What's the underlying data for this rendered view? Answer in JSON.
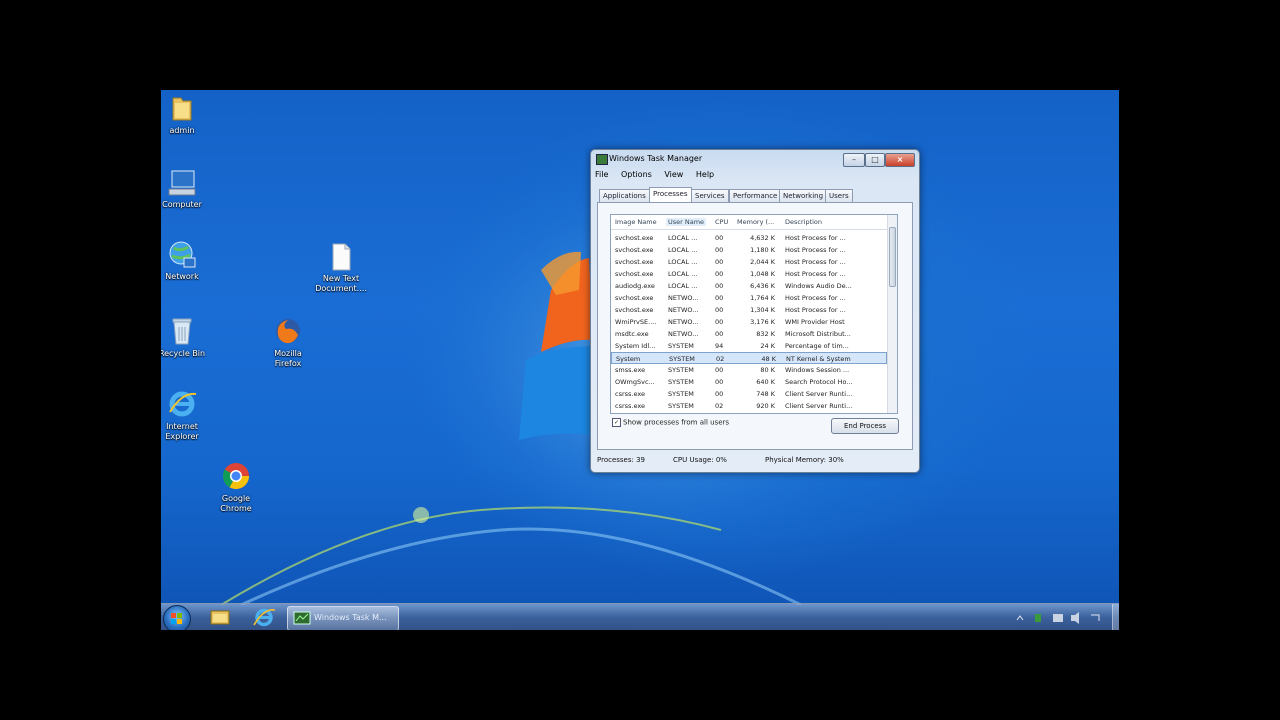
{
  "desktop_icons": [
    {
      "label": "admin",
      "icon": "folder-icon"
    },
    {
      "label": "Computer",
      "icon": "computer-icon"
    },
    {
      "label": "Network",
      "icon": "network-icon"
    },
    {
      "label": "Recycle Bin",
      "icon": "recycle-bin-icon"
    },
    {
      "label": "Internet Explorer",
      "icon": "internet-explorer-icon"
    },
    {
      "label": "Google Chrome",
      "icon": "chrome-icon"
    },
    {
      "label": "Mozilla Firefox",
      "icon": "firefox-icon"
    },
    {
      "label": "New Text Document....",
      "icon": "text-document-icon"
    }
  ],
  "task_manager": {
    "title": "Windows Task Manager",
    "menu": [
      "File",
      "Options",
      "View",
      "Help"
    ],
    "tabs": [
      "Applications",
      "Processes",
      "Services",
      "Performance",
      "Networking",
      "Users"
    ],
    "active_tab": "Processes",
    "columns": [
      "Image Name",
      "User Name",
      "CPU",
      "Memory (...",
      "Description"
    ],
    "rows": [
      [
        "svchost.exe",
        "LOCAL ...",
        "00",
        "4,632 K",
        "Host Process for ..."
      ],
      [
        "svchost.exe",
        "LOCAL ...",
        "00",
        "1,180 K",
        "Host Process for ..."
      ],
      [
        "svchost.exe",
        "LOCAL ...",
        "00",
        "2,044 K",
        "Host Process for ..."
      ],
      [
        "svchost.exe",
        "LOCAL ...",
        "00",
        "1,048 K",
        "Host Process for ..."
      ],
      [
        "audiodg.exe",
        "LOCAL ...",
        "00",
        "6,436 K",
        "Windows Audio De..."
      ],
      [
        "svchost.exe",
        "NETWO...",
        "00",
        "1,764 K",
        "Host Process for ..."
      ],
      [
        "svchost.exe",
        "NETWO...",
        "00",
        "1,304 K",
        "Host Process for ..."
      ],
      [
        "WmiPrvSE....",
        "NETWO...",
        "00",
        "3,176 K",
        "WMI Provider Host"
      ],
      [
        "msdtc.exe",
        "NETWO...",
        "00",
        "832 K",
        "Microsoft Distribut..."
      ],
      [
        "System Idl...",
        "SYSTEM",
        "94",
        "24 K",
        "Percentage of tim..."
      ],
      [
        "System",
        "SYSTEM",
        "02",
        "48 K",
        "NT Kernel & System"
      ],
      [
        "smss.exe",
        "SYSTEM",
        "00",
        "80 K",
        "Windows Session ..."
      ],
      [
        "OWmgSvc...",
        "SYSTEM",
        "00",
        "640 K",
        "Search Protocol Ho..."
      ],
      [
        "csrss.exe",
        "SYSTEM",
        "00",
        "748 K",
        "Client Server Runti..."
      ],
      [
        "csrss.exe",
        "SYSTEM",
        "02",
        "920 K",
        "Client Server Runti..."
      ]
    ],
    "selected_row": 10,
    "show_all_label": "Show processes from all users",
    "end_process_label": "End Process",
    "status": {
      "processes": "Processes: 39",
      "cpu": "CPU Usage: 0%",
      "memory": "Physical Memory: 30%"
    }
  },
  "taskbar": {
    "active_window_label": "Windows Task M..."
  }
}
